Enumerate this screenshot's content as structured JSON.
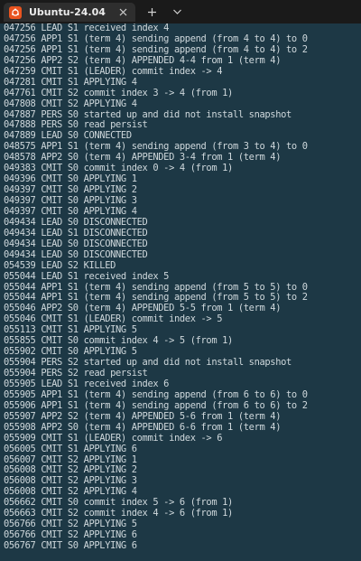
{
  "window": {
    "tab": {
      "title": "Ubuntu-24.04",
      "icon": "ubuntu-icon",
      "close_icon": "close-icon"
    },
    "new_tab_icon": "plus-icon",
    "dropdown_icon": "chevron-down-icon"
  },
  "colors": {
    "terminal_bg": "#1d3845",
    "terminal_fg": "#cfd8dc",
    "tabbar_bg": "#1a1a1a",
    "tab_bg": "#2e2e2e",
    "ubuntu_orange": "#e95420"
  },
  "terminal": {
    "lines": [
      "047256 LEAD S1 received index 4",
      "047256 APP1 S1 (term 4) sending append (from 4 to 4) to 0",
      "047256 APP1 S1 (term 4) sending append (from 4 to 4) to 2",
      "047256 APP2 S2 (term 4) APPENDED 4-4 from 1 (term 4)",
      "047259 CMIT S1 (LEADER) commit index -> 4",
      "047281 CMIT S1 APPLYING 4",
      "047761 CMIT S2 commit index 3 -> 4 (from 1)",
      "047808 CMIT S2 APPLYING 4",
      "047887 PERS S0 started up and did not install snapshot",
      "047888 PERS S0 read persist",
      "047889 LEAD S0 CONNECTED",
      "048575 APP1 S1 (term 4) sending append (from 3 to 4) to 0",
      "048578 APP2 S0 (term 4) APPENDED 3-4 from 1 (term 4)",
      "049383 CMIT S0 commit index 0 -> 4 (from 1)",
      "049396 CMIT S0 APPLYING 1",
      "049397 CMIT S0 APPLYING 2",
      "049397 CMIT S0 APPLYING 3",
      "049397 CMIT S0 APPLYING 4",
      "049434 LEAD S0 DISCONNECTED",
      "049434 LEAD S1 DISCONNECTED",
      "049434 LEAD S0 DISCONNECTED",
      "049434 LEAD S0 DISCONNECTED",
      "054539 LEAD S2 KILLED",
      "055044 LEAD S1 received index 5",
      "055044 APP1 S1 (term 4) sending append (from 5 to 5) to 0",
      "055044 APP1 S1 (term 4) sending append (from 5 to 5) to 2",
      "055046 APP2 S0 (term 4) APPENDED 5-5 from 1 (term 4)",
      "055046 CMIT S1 (LEADER) commit index -> 5",
      "055113 CMIT S1 APPLYING 5",
      "055855 CMIT S0 commit index 4 -> 5 (from 1)",
      "055902 CMIT S0 APPLYING 5",
      "055904 PERS S2 started up and did not install snapshot",
      "055904 PERS S2 read persist",
      "055905 LEAD S1 received index 6",
      "055905 APP1 S1 (term 4) sending append (from 6 to 6) to 0",
      "055906 APP1 S1 (term 4) sending append (from 6 to 6) to 2",
      "055907 APP2 S2 (term 4) APPENDED 5-6 from 1 (term 4)",
      "055908 APP2 S0 (term 4) APPENDED 6-6 from 1 (term 4)",
      "055909 CMIT S1 (LEADER) commit index -> 6",
      "056005 CMIT S1 APPLYING 6",
      "056007 CMIT S2 APPLYING 1",
      "056008 CMIT S2 APPLYING 2",
      "056008 CMIT S2 APPLYING 3",
      "056008 CMIT S2 APPLYING 4",
      "056662 CMIT S0 commit index 5 -> 6 (from 1)",
      "056663 CMIT S2 commit index 4 -> 6 (from 1)",
      "056766 CMIT S2 APPLYING 5",
      "056766 CMIT S2 APPLYING 6",
      "056767 CMIT S0 APPLYING 6"
    ]
  }
}
